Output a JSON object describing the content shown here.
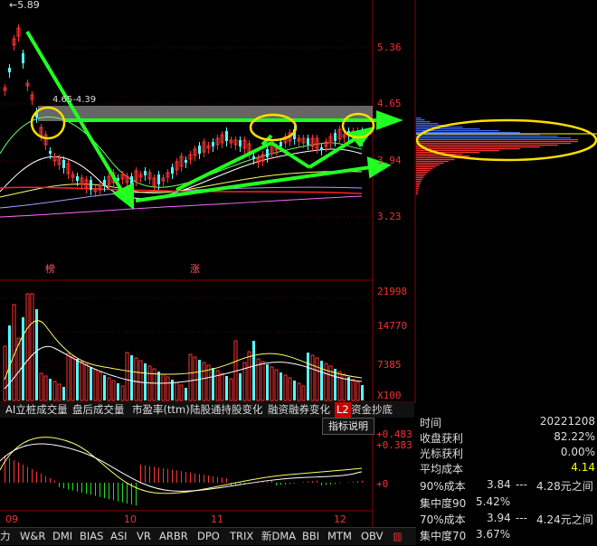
{
  "price_chart": {
    "max_marker": "5.89",
    "high_low_label": "4.65-4.39",
    "y_ticks": [
      "5.36",
      "4.65",
      "3.94",
      "3.23"
    ],
    "event_labels": [
      {
        "text": "榜"
      },
      {
        "text": "涨"
      }
    ]
  },
  "volume_chart": {
    "y_ticks": [
      "21998",
      "14770",
      "7385"
    ],
    "unit": "X100"
  },
  "indicator_tabs": [
    {
      "label": "AI立桩成交量"
    },
    {
      "label": "盘后成交量"
    },
    {
      "label": "市盈率(ttm)"
    },
    {
      "label": "陆股通持股变化"
    },
    {
      "label": "融资融券变化"
    },
    {
      "label": "L2"
    },
    {
      "label": "资金抄底"
    }
  ],
  "indicator_help": "指标说明",
  "macd_chart": {
    "y_ticks": [
      "+0.483",
      "+0.383",
      "+0"
    ],
    "left_label": "力"
  },
  "x_axis": {
    "months": [
      "09",
      "10",
      "11",
      "12"
    ]
  },
  "bottom_tabs": [
    "W&R",
    "DMI",
    "BIAS",
    "ASI",
    "VR",
    "ARBR",
    "DPO",
    "TRIX",
    "新DMA",
    "BBI",
    "MTM",
    "OBV"
  ],
  "chip_info": {
    "rows": [
      {
        "label": "时间",
        "value": "20221208"
      },
      {
        "label": "收盘获利",
        "value": "82.22%"
      },
      {
        "label": "光标获利",
        "value": "0.00%"
      },
      {
        "label": "平均成本",
        "value": "4.14"
      }
    ],
    "cost_rows": [
      {
        "label": "90%成本",
        "value": "3.84",
        "dash": "---",
        "range": "4.28元之间"
      },
      {
        "label": "集中度90",
        "value": "5.42%",
        "dash": "",
        "range": ""
      },
      {
        "label": "70%成本",
        "value": "3.94",
        "dash": "---",
        "range": "4.24元之间"
      },
      {
        "label": "集中度70",
        "value": "3.67%",
        "dash": "",
        "range": ""
      }
    ]
  },
  "colors": {
    "up": "#ff3333",
    "down": "#54ffff",
    "accent_green": "#22ff22",
    "highlight_yellow": "#ffdd00",
    "avg_cost": "#ffff00"
  }
}
